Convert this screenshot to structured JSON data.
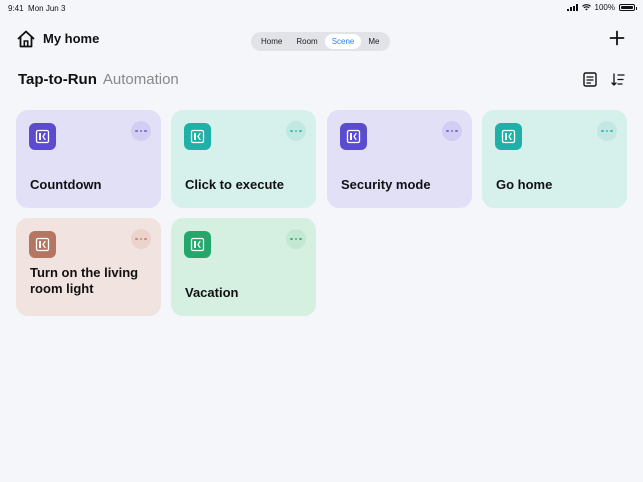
{
  "status_bar": {
    "time": "9:41",
    "date": "Mon Jun 3",
    "battery": "100%"
  },
  "header": {
    "title": "My home",
    "tabs": [
      {
        "label": "Home",
        "active": false
      },
      {
        "label": "Room",
        "active": false
      },
      {
        "label": "Scene",
        "active": true
      },
      {
        "label": "Me",
        "active": false
      }
    ]
  },
  "section": {
    "title": "Tap-to-Run",
    "subtitle": "Automation"
  },
  "cards": [
    {
      "title": "Countdown",
      "bg": "#e2e0f7",
      "icon_bg": "#5b4ccf",
      "more_bg": "#d2cdf2",
      "dot": "#7b6ddf"
    },
    {
      "title": "Click to execute",
      "bg": "#d6f0ec",
      "icon_bg": "#1fb1a8",
      "more_bg": "#c3e8e3",
      "dot": "#3fbfb6"
    },
    {
      "title": "Security mode",
      "bg": "#e2e0f7",
      "icon_bg": "#5b4ccf",
      "more_bg": "#d2cdf2",
      "dot": "#7b6ddf"
    },
    {
      "title": "Go home",
      "bg": "#d6f0ec",
      "icon_bg": "#1fb1a8",
      "more_bg": "#c3e8e3",
      "dot": "#3fbfb6"
    },
    {
      "title": "Turn on the living room light",
      "bg": "#f1e3df",
      "icon_bg": "#b57563",
      "more_bg": "#ecd3cc",
      "dot": "#c98b7a"
    },
    {
      "title": "Vacation",
      "bg": "#d5f0e1",
      "icon_bg": "#22a86b",
      "more_bg": "#c2e8d4",
      "dot": "#3fb47f"
    }
  ],
  "colors": {
    "accent": "#2e7cf6",
    "background": "#f5f6fa"
  },
  "icons": {
    "home": "home-icon",
    "add": "plus-icon",
    "log": "log-icon",
    "sort": "sort-icon",
    "scene": "scene-icon",
    "more": "more-icon"
  }
}
